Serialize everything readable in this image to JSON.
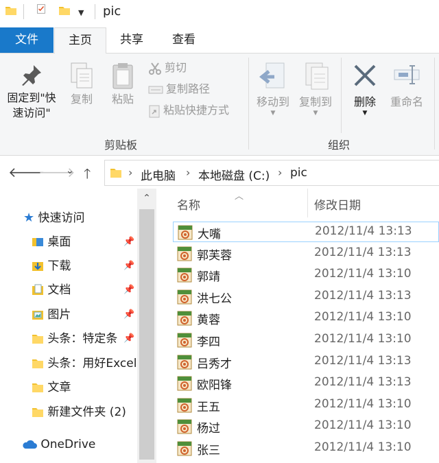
{
  "window": {
    "title": "pic"
  },
  "tabs": {
    "file": "文件",
    "home": "主页",
    "share": "共享",
    "view": "查看"
  },
  "ribbon": {
    "pin": "固定到\"快速访问\"",
    "pin_line1": "固定到\"快",
    "pin_line2": "速访问\"",
    "copy": "复制",
    "paste": "粘贴",
    "cut": "剪切",
    "copy_path": "复制路径",
    "paste_shortcut": "粘贴快捷方式",
    "clipboard_group": "剪贴板",
    "move_to": "移动到",
    "copy_to": "复制到",
    "delete": "删除",
    "rename": "重命名",
    "organize_group": "组织"
  },
  "address": {
    "crumbs": [
      "此电脑",
      "本地磁盘 (C:)",
      "pic"
    ]
  },
  "nav": {
    "quick_access": "快速访问",
    "items": [
      {
        "label": "桌面",
        "pinned": true,
        "icon": "desktop-folder-icon"
      },
      {
        "label": "下载",
        "pinned": true,
        "icon": "download-folder-icon"
      },
      {
        "label": "文档",
        "pinned": true,
        "icon": "documents-folder-icon"
      },
      {
        "label": "图片",
        "pinned": true,
        "icon": "pictures-folder-icon"
      },
      {
        "label": "头条：特定条",
        "pinned": true,
        "icon": "folder-icon"
      },
      {
        "label": "头条：用好Excel",
        "pinned": false,
        "icon": "folder-icon"
      },
      {
        "label": "文章",
        "pinned": false,
        "icon": "folder-icon"
      },
      {
        "label": "新建文件夹 (2)",
        "pinned": false,
        "icon": "folder-icon"
      }
    ],
    "onedrive": "OneDrive"
  },
  "filelist": {
    "columns": {
      "name": "名称",
      "modified": "修改日期"
    },
    "files": [
      {
        "name": "大嘴",
        "date": "2012/11/4 13:13"
      },
      {
        "name": "郭芙蓉",
        "date": "2012/11/4 13:13"
      },
      {
        "name": "郭靖",
        "date": "2012/11/4 13:10"
      },
      {
        "name": "洪七公",
        "date": "2012/11/4 13:13"
      },
      {
        "name": "黄蓉",
        "date": "2012/11/4 13:10"
      },
      {
        "name": "李四",
        "date": "2012/11/4 13:10"
      },
      {
        "name": "吕秀才",
        "date": "2012/11/4 13:13"
      },
      {
        "name": "欧阳锋",
        "date": "2012/11/4 13:13"
      },
      {
        "name": "王五",
        "date": "2012/11/4 13:10"
      },
      {
        "name": "杨过",
        "date": "2012/11/4 13:10"
      },
      {
        "name": "张三",
        "date": "2012/11/4 13:10"
      }
    ],
    "file_icon": "jpg-file-icon"
  },
  "colors": {
    "accent": "#1979ca",
    "folder": "#f2c12e",
    "selection_border": "#99d1ff"
  }
}
